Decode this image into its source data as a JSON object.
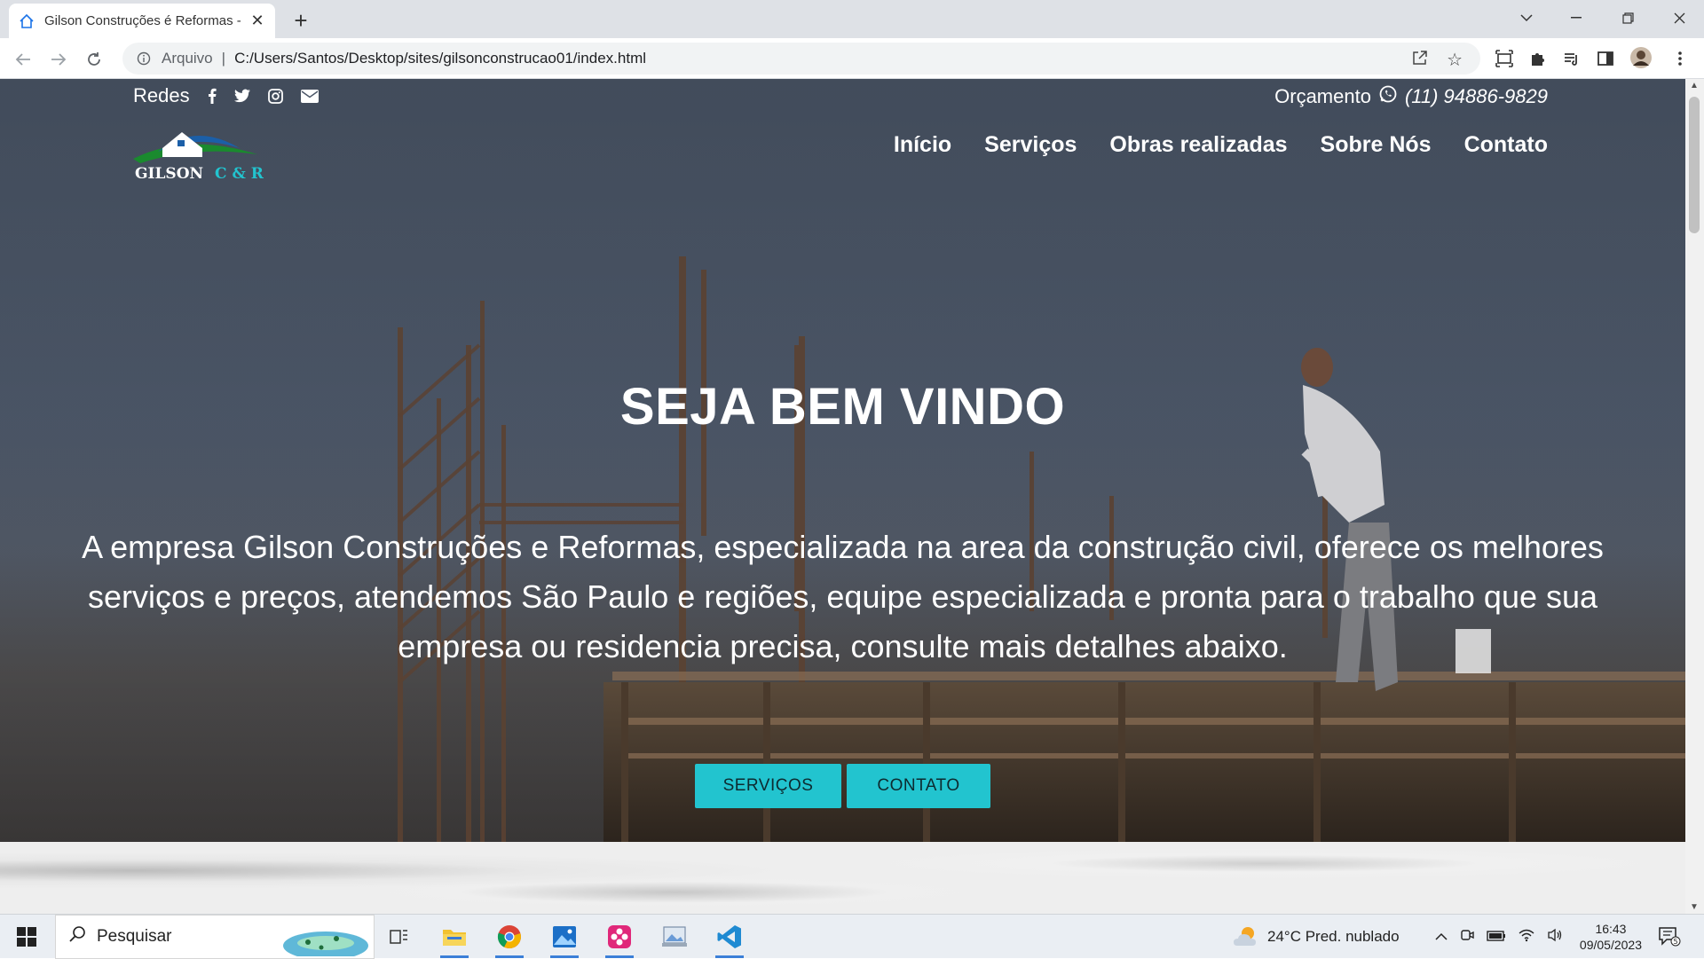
{
  "browser": {
    "tab_title": "Gilson Construções é Reformas -",
    "url_scheme": "Arquivo",
    "url": "C:/Users/Santos/Desktop/sites/gilsonconstrucao01/index.html"
  },
  "site": {
    "topbar": {
      "redes_label": "Redes",
      "social_icons": [
        "facebook-icon",
        "twitter-icon",
        "instagram-icon",
        "envelope-icon"
      ],
      "orcamento_label": "Orçamento",
      "phone": "(11) 94886-9829"
    },
    "logo": {
      "text1": "GILSON",
      "text2": "C & R"
    },
    "nav": [
      "Início",
      "Serviços",
      "Obras realizadas",
      "Sobre Nós",
      "Contato"
    ],
    "hero": {
      "title": "SEJA BEM VINDO",
      "lead": "A empresa Gilson Construções e Reformas, especializada na area da construção civil, oferece os melhores serviços e preços, atendemos São Paulo e regiões, equipe especializada e pronta para o trabalho que sua empresa ou residencia precisa, consulte mais detalhes abaixo.",
      "button_services": "SERVIÇOS",
      "button_contact": "CONTATO"
    }
  },
  "taskbar": {
    "search_placeholder": "Pesquisar",
    "weather": "24°C  Pred. nublado",
    "time": "16:43",
    "date": "09/05/2023",
    "notifications": "5"
  },
  "colors": {
    "accent": "#22c4cf",
    "logo_green": "#1a8a2e",
    "logo_blue": "#1b5fa8"
  }
}
